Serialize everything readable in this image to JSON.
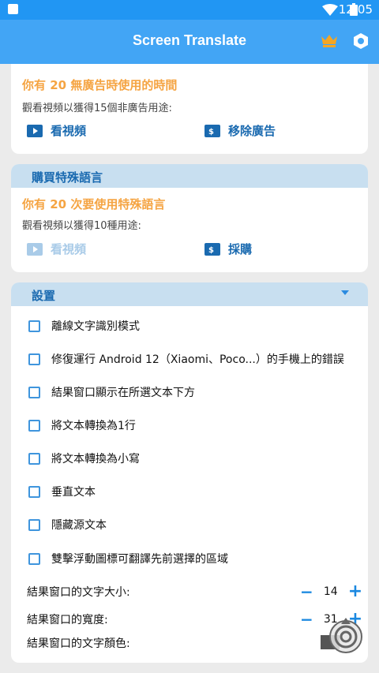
{
  "status_bar": {
    "time": "12:05"
  },
  "app_bar": {
    "title": "Screen Translate"
  },
  "ad_card": {
    "free_time_text": "你有 20 無廣告時使用的時間",
    "watch_info": "觀看視頻以獲得15個非廣告用途:",
    "watch_video_label": "看視頻",
    "remove_ads_label": "移除廣告"
  },
  "lang_card": {
    "header": "購買特殊語言",
    "uses_text": "你有 20 次要使用特殊語言",
    "watch_info": "觀看視頻以獲得10種用途:",
    "watch_video_label": "看視頻",
    "purchase_label": "採購"
  },
  "settings_card": {
    "header": "設置",
    "checkboxes": [
      {
        "label": "離線文字識別模式",
        "checked": false
      },
      {
        "label": "修復運行 Android 12（Xiaomi、Poco...）的手機上的錯誤",
        "checked": false
      },
      {
        "label": "結果窗口顯示在所選文本下方",
        "checked": false
      },
      {
        "label": "將文本轉換為1行",
        "checked": false
      },
      {
        "label": "將文本轉換為小寫",
        "checked": false
      },
      {
        "label": "垂直文本",
        "checked": false
      },
      {
        "label": "隱藏源文本",
        "checked": false
      },
      {
        "label": "雙擊浮動圖標可翻譯先前選擇的區域",
        "checked": false
      }
    ],
    "font_size_label": "結果窗口的文字大小:",
    "font_size_value": "14",
    "width_label": "結果窗口的寬度:",
    "width_value": "31",
    "text_color_label": "結果窗口的文字顏色:",
    "text_color_value": "#555555"
  },
  "colors": {
    "primary": "#42a5f5",
    "status_bar": "#2196f3",
    "accent_orange": "#f5a442",
    "link_blue": "#1a6ab0",
    "card_header": "#c8dff0"
  },
  "icons": [
    "wifi-icon",
    "battery-icon",
    "crown-icon",
    "settings-hex-icon",
    "video-icon",
    "money-icon",
    "minus-icon",
    "plus-icon",
    "floating-target-icon"
  ]
}
